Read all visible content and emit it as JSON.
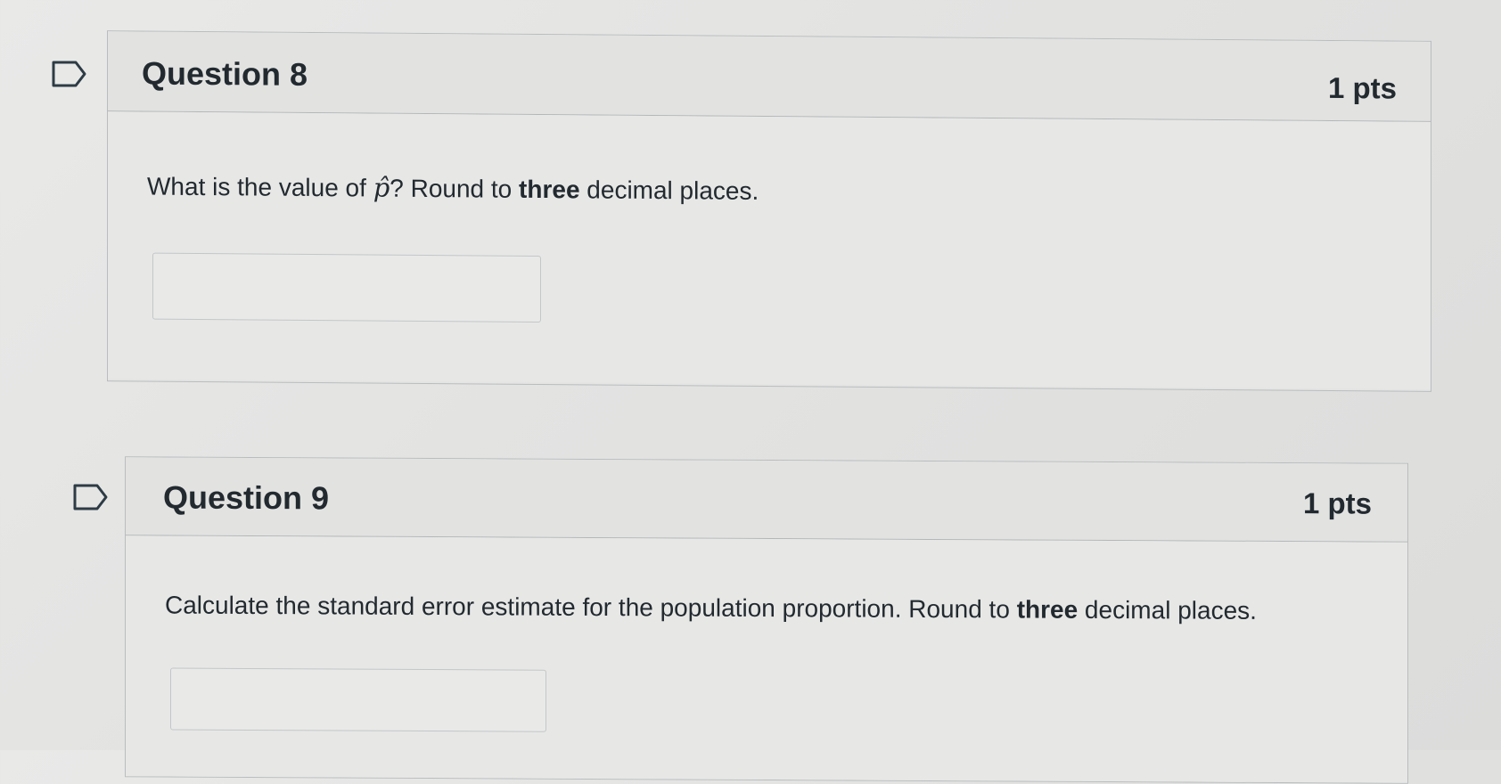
{
  "questions": [
    {
      "title": "Question 8",
      "points": "1 pts",
      "text_before": "What is the value of ",
      "symbol": "p̂",
      "text_middle": "? Round to ",
      "emphasis": "three",
      "text_after": " decimal places.",
      "answer_value": ""
    },
    {
      "title": "Question 9",
      "points": "1 pts",
      "text_before": "Calculate the standard error estimate for the population proportion. Round to ",
      "emphasis": "three",
      "text_after": " decimal places.",
      "answer_value": ""
    }
  ],
  "icons": {
    "flag": "flag-question-icon"
  },
  "colors": {
    "border": "#b9bcbe",
    "text": "#222a30"
  }
}
